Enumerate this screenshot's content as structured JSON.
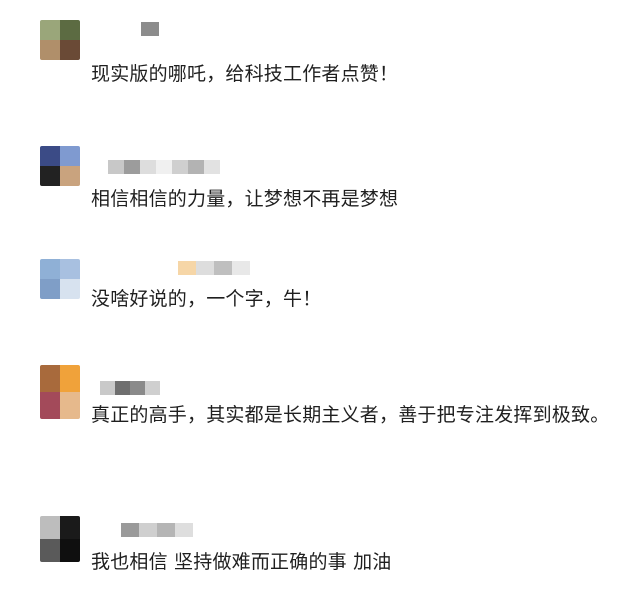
{
  "comments": [
    {
      "text": "现实版的哪吒，给科技工作者点赞！",
      "avatar_colors": [
        "#9aa67a",
        "#5c6b42",
        "#b08f6a",
        "#6a4a36"
      ],
      "name_blocks": [
        "#8c8c8c"
      ]
    },
    {
      "text": "相信相信的力量，让梦想不再是梦想",
      "avatar_colors": [
        "#3b4b86",
        "#7f9ad0",
        "#222222",
        "#c9a37e"
      ],
      "name_blocks": [
        "#c8c8c8",
        "#9c9c9c",
        "#dddddd",
        "#f0f0f0",
        "#cfcfcf",
        "#b3b3b3",
        "#e2e2e2"
      ]
    },
    {
      "text": "没啥好说的，一个字，牛！",
      "avatar_colors": [
        "#8fb0d6",
        "#a8c0e0",
        "#7f9ec7",
        "#d7e2ef"
      ],
      "name_blocks": [
        "#f6d6a7",
        "#dddddd",
        "#bfbfbf",
        "#e8e8e8"
      ]
    },
    {
      "text": "真正的高手，其实都是长期主义者，善于把专注发挥到极致。",
      "avatar_colors": [
        "#a86a3c",
        "#f0a23a",
        "#a34a5a",
        "#e6b98c"
      ],
      "name_blocks": [
        "#c9c9c9",
        "#6f6f6f",
        "#8a8a8a",
        "#cfcfcf"
      ]
    },
    {
      "text": "我也相信 坚持做难而正确的事 加油",
      "avatar_colors": [
        "#bdbdbd",
        "#1a1a1a",
        "#5a5a5a",
        "#0f0f0f"
      ],
      "name_blocks": [
        "#9a9a9a",
        "#cfcfcf",
        "#b5b5b5",
        "#dedede"
      ]
    }
  ]
}
